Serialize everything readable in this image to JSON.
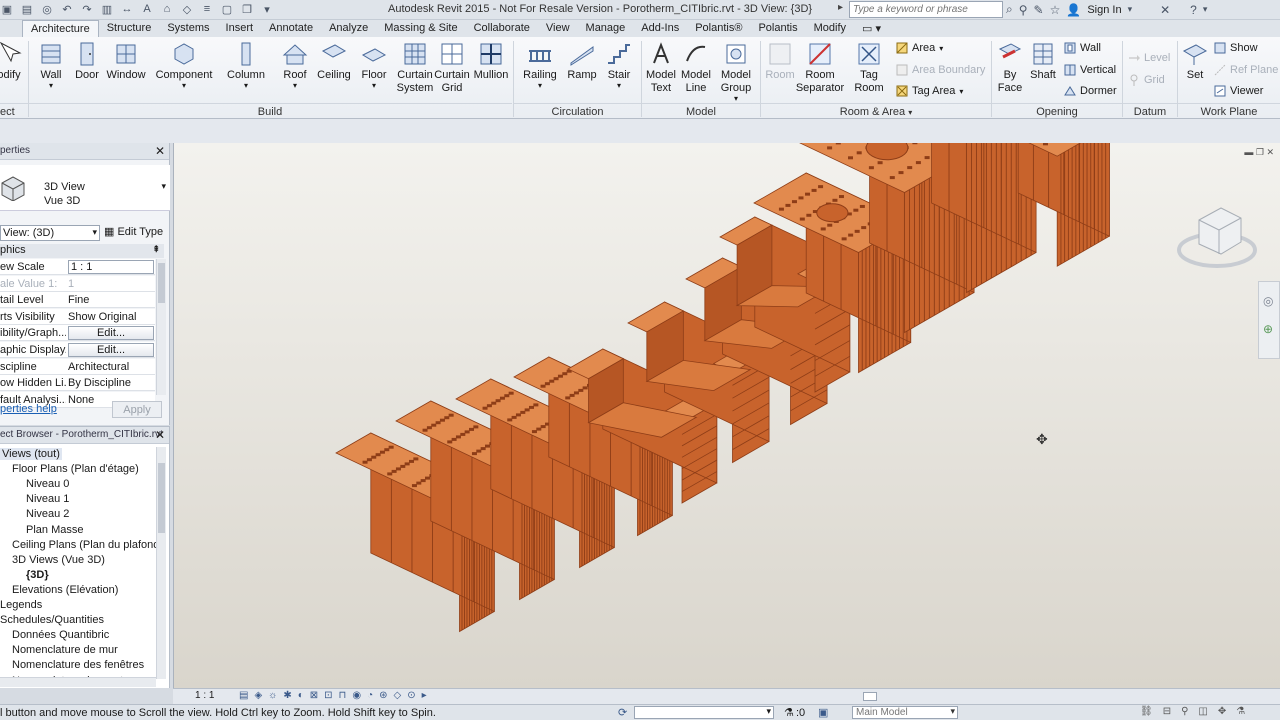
{
  "window": {
    "title": "Autodesk Revit 2015 - Not For Resale Version -     Porotherm_CITIbric.rvt - 3D View: {3D}",
    "search_placeholder": "Type a keyword or phrase",
    "sign_in": "Sign In"
  },
  "tabs": [
    "Architecture",
    "Structure",
    "Systems",
    "Insert",
    "Annotate",
    "Analyze",
    "Massing & Site",
    "Collaborate",
    "View",
    "Manage",
    "Add-Ins",
    "Polantis®",
    "Polantis",
    "Modify"
  ],
  "ribbon": {
    "modify": "odify",
    "select": "ect",
    "build": [
      "Wall",
      "Door",
      "Window",
      "Component",
      "Column",
      "Roof",
      "Ceiling",
      "Floor",
      "Curtain\nSystem",
      "Curtain\nGrid",
      "Mullion"
    ],
    "circulation": [
      "Railing",
      "Ramp",
      "Stair"
    ],
    "model": [
      "Model\nText",
      "Model\nLine",
      "Model\nGroup"
    ],
    "room_area": {
      "room": "Room",
      "room_separator": "Room\nSeparator",
      "tag_room": "Tag\nRoom",
      "area": "Area",
      "area_boundary": "Area Boundary",
      "tag_area": "Tag Area"
    },
    "opening": {
      "by_face": "By\nFace",
      "shaft": "Shaft",
      "wall": "Wall",
      "vertical": "Vertical",
      "dormer": "Dormer"
    },
    "datum": {
      "level": "Level",
      "grid": "Grid"
    },
    "work_plane": {
      "set": "Set",
      "show": "Show",
      "ref_plane": "Ref  Plane",
      "viewer": "Viewer"
    },
    "panels": {
      "build": "Build",
      "circulation": "Circulation",
      "model": "Model",
      "room_area": "Room & Area",
      "opening": "Opening",
      "datum": "Datum",
      "work_plane": "Work Plane"
    }
  },
  "properties": {
    "header": "perties",
    "type_name": "3D View",
    "type_sub": "Vue 3D",
    "view_filter": "View: (3D)",
    "edit_type": "Edit Type",
    "group": "phics",
    "rows": [
      {
        "k": "ew Scale",
        "v": "1 : 1"
      },
      {
        "k": "ale Value   1:",
        "v": "1"
      },
      {
        "k": "tail Level",
        "v": "Fine"
      },
      {
        "k": "rts Visibility",
        "v": "Show Original"
      },
      {
        "k": "ibility/Graph...",
        "v": "Edit..."
      },
      {
        "k": "aphic Display...",
        "v": "Edit..."
      },
      {
        "k": "scipline",
        "v": "Architectural"
      },
      {
        "k": "ow Hidden Li...",
        "v": "By Discipline"
      },
      {
        "k": "fault Analysi...",
        "v": "None"
      }
    ],
    "help": "perties help",
    "apply": "Apply"
  },
  "browser": {
    "header": "ect Browser - Porotherm_CITIbric.rvt",
    "items": [
      {
        "t": "Views (tout)",
        "lvl": 0
      },
      {
        "t": "Floor Plans (Plan d'étage)",
        "lvl": 1
      },
      {
        "t": "Niveau 0",
        "lvl": 2
      },
      {
        "t": "Niveau 1",
        "lvl": 2
      },
      {
        "t": "Niveau 2",
        "lvl": 2
      },
      {
        "t": "Plan Masse",
        "lvl": 2
      },
      {
        "t": "Ceiling Plans (Plan du plafond",
        "lvl": 1
      },
      {
        "t": "3D Views (Vue 3D)",
        "lvl": 1
      },
      {
        "t": "{3D}",
        "lvl": 2
      },
      {
        "t": "Elevations (Elévation)",
        "lvl": 1
      },
      {
        "t": "Legends",
        "lvl": 0
      },
      {
        "t": "Schedules/Quantities",
        "lvl": 0
      },
      {
        "t": "Données Quantibric",
        "lvl": 1
      },
      {
        "t": "Nomenclature de mur",
        "lvl": 1
      },
      {
        "t": "Nomenclature des fenêtres",
        "lvl": 1
      },
      {
        "t": "Nomenclature des portes",
        "lvl": 1
      }
    ]
  },
  "viewbar": {
    "scale": "1 : 1"
  },
  "status": {
    "hint": "l button and move mouse to Scroll the view. Hold Ctrl key to Zoom. Hold Shift key to Spin.",
    "filter_count": ":0",
    "model": "Main Model"
  },
  "colors": {
    "brick": "#c8632c",
    "brick_dark": "#8e3d17",
    "brick_light": "#e28a4e"
  }
}
